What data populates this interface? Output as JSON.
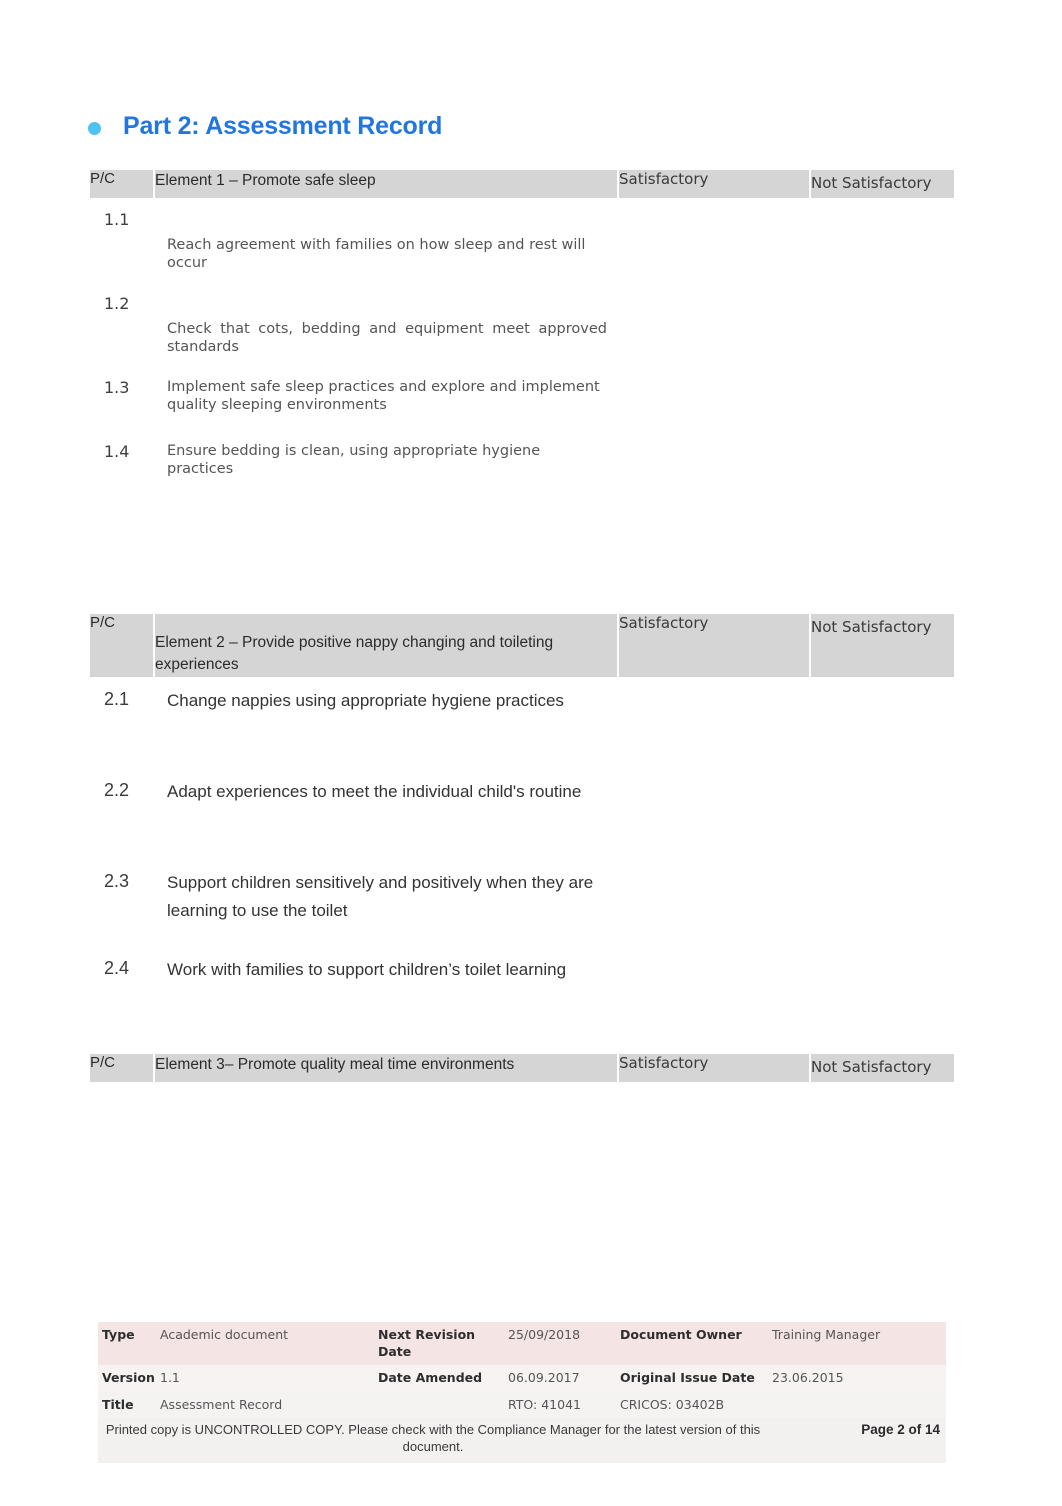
{
  "heading": {
    "bullet_color": "#4FC3F0",
    "text_color": "#2176E0",
    "title": "Part 2: Assessment Record"
  },
  "tables": [
    {
      "id": "element-1",
      "header": {
        "pc": "P/C",
        "element": "Element 1 – Promote safe sleep",
        "satisfactory": "Satisfactory",
        "not_satisfactory": "Not Satisfactory"
      },
      "rows": [
        {
          "num": "1.1",
          "desc": "Reach agreement with families on how sleep and rest will occur"
        },
        {
          "num": "1.2",
          "desc": "Check that cots, bedding and equipment meet approved standards"
        },
        {
          "num": "1.3",
          "desc": "Implement safe sleep practices and explore and implement quality sleeping environments"
        },
        {
          "num": "1.4",
          "desc": "Ensure bedding is clean, using appropriate hygiene practices"
        }
      ]
    },
    {
      "id": "element-2",
      "header": {
        "pc": "P/C",
        "element": "Element 2 – Provide positive nappy changing and toileting experiences",
        "satisfactory": "Satisfactory",
        "not_satisfactory": "Not Satisfactory"
      },
      "rows": [
        {
          "num": "2.1",
          "desc": "Change nappies using appropriate hygiene practices"
        },
        {
          "num": "2.2",
          "desc": "Adapt experiences to meet the individual child's routine"
        },
        {
          "num": "2.3",
          "desc": "Support children sensitively and positively when they are learning to use the toilet"
        },
        {
          "num": "2.4",
          "desc": "Work with families to support children’s toilet learning"
        }
      ]
    },
    {
      "id": "element-3",
      "header": {
        "pc": "P/C",
        "element": "Element 3– Promote quality meal time environments",
        "satisfactory": "Satisfactory",
        "not_satisfactory": "Not Satisfactory"
      },
      "rows": [
        {
          "num": "",
          "desc": ""
        },
        {
          "num": "",
          "desc": ""
        }
      ]
    }
  ],
  "footer": {
    "type_label": "Type",
    "type_value": "Academic document",
    "next_revision_label": "Next Revision Date",
    "next_revision_value": "25/09/2018",
    "document_owner_label": "Document Owner",
    "document_owner_value": "Training Manager",
    "version_label": "Version",
    "version_value": "1.1",
    "date_amended_label": "Date Amended",
    "date_amended_value": "06.09.2017",
    "original_issue_label": "Original Issue Date",
    "original_issue_value": "23.06.2015",
    "title_label": "Title",
    "title_value": "Assessment Record",
    "rto": "RTO: 41041",
    "cricos": "CRICOS: 03402B",
    "notice": "Printed copy is UNCONTROLLED COPY. Please check with the Compliance Manager for the latest version of this document.",
    "page": "Page 2 of 14"
  }
}
